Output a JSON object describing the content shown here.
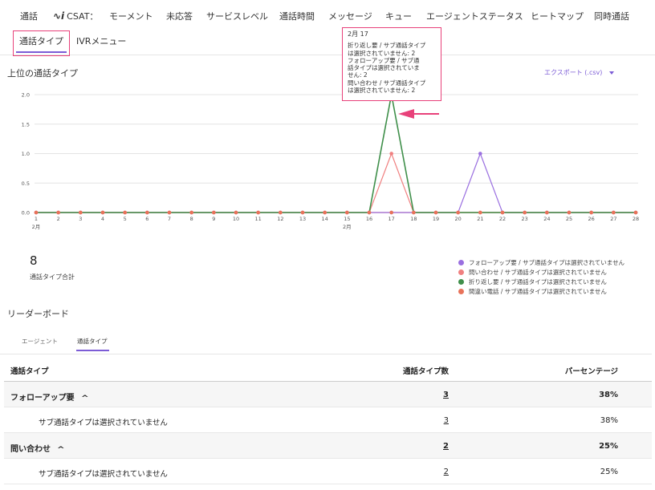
{
  "nav": {
    "tabs": [
      "通話",
      "CSAT：",
      "モーメント",
      "未応答",
      "サービスレベル",
      "通話時間",
      "メッセージ",
      "キュー",
      "エージェントステータス",
      "ヒートマップ",
      "同時通話"
    ],
    "csat_logo": "∿i",
    "tabs2": [
      "通話タイプ",
      "IVRメニュー"
    ],
    "active_tab": "通話タイプ"
  },
  "section": {
    "title": "上位の通話タイプ",
    "export_label": "エクスポート (.csv)"
  },
  "tooltip": {
    "date": "2月 17",
    "lines": [
      "折り返し要 / サブ通話タイプ",
      "は選択されていません: 2",
      "フォローアップ要 / サブ通",
      "話タイプは選択されていま",
      "せん: 2",
      "問い合わせ / サブ通話タイプ",
      "は選択されていません: 2"
    ]
  },
  "chart_data": {
    "type": "line",
    "x": [
      1,
      2,
      3,
      4,
      5,
      6,
      7,
      8,
      9,
      10,
      11,
      12,
      13,
      14,
      15,
      16,
      17,
      18,
      19,
      20,
      21,
      22,
      23,
      24,
      25,
      26,
      27,
      28
    ],
    "x_tick_labels": [
      "1",
      "2",
      "3",
      "4",
      "5",
      "6",
      "7",
      "8",
      "9",
      "10",
      "11",
      "12",
      "13",
      "14",
      "15",
      "16",
      "17",
      "18",
      "19",
      "20",
      "21",
      "22",
      "23",
      "24",
      "25",
      "26",
      "27",
      "28"
    ],
    "x_sublabels": {
      "1": "2月",
      "15": "2月"
    },
    "y_ticks": [
      "0.0",
      "0.5",
      "1.0",
      "1.5",
      "2.0"
    ],
    "ylim": [
      0,
      2
    ],
    "grid": true,
    "series": [
      {
        "name": "フォローアップ要 / サブ通話タイプは選択されていません",
        "color": "#9a6fe0",
        "values": [
          0,
          0,
          0,
          0,
          0,
          0,
          0,
          0,
          0,
          0,
          0,
          0,
          0,
          0,
          0,
          0,
          0,
          0,
          0,
          0,
          1,
          0,
          0,
          0,
          0,
          0,
          0,
          0
        ]
      },
      {
        "name": "問い合わせ / サブ通話タイプは選択されていません",
        "color": "#f08080",
        "values": [
          0,
          0,
          0,
          0,
          0,
          0,
          0,
          0,
          0,
          0,
          0,
          0,
          0,
          0,
          0,
          0,
          1,
          0,
          0,
          0,
          0,
          0,
          0,
          0,
          0,
          0,
          0,
          0
        ]
      },
      {
        "name": "折り返し要 / サブ通話タイプは選択されていません",
        "color": "#3f8f4a",
        "values": [
          0,
          0,
          0,
          0,
          0,
          0,
          0,
          0,
          0,
          0,
          0,
          0,
          0,
          0,
          0,
          0,
          2,
          0,
          0,
          0,
          0,
          0,
          0,
          0,
          0,
          0,
          0,
          0
        ]
      },
      {
        "name": "間違い電話 / サブ通話タイプは選択されていません",
        "color": "#e8735a",
        "values": [
          0,
          0,
          0,
          0,
          0,
          0,
          0,
          0,
          0,
          0,
          0,
          0,
          0,
          0,
          0,
          0,
          0,
          0,
          0,
          0,
          0,
          0,
          0,
          0,
          0,
          0,
          0,
          0
        ]
      }
    ],
    "legend_position": "right"
  },
  "summary": {
    "total": "8",
    "total_label": "通話タイプ合計"
  },
  "leaderboard": {
    "title": "リーダーボード",
    "tabs": [
      "エージェント",
      "通話タイプ"
    ],
    "columns": [
      "通話タイプ",
      "通話タイプ数",
      "パーセンテージ"
    ],
    "rows": [
      {
        "kind": "group",
        "name": "フォローアップ要",
        "count": "3",
        "pct": "38%"
      },
      {
        "kind": "sub",
        "name": "サブ通話タイプは選択されていません",
        "count": "3",
        "pct": "38%"
      },
      {
        "kind": "group",
        "name": "問い合わせ",
        "count": "2",
        "pct": "25%"
      },
      {
        "kind": "sub",
        "name": "サブ通話タイプは選択されていません",
        "count": "2",
        "pct": "25%"
      }
    ]
  }
}
